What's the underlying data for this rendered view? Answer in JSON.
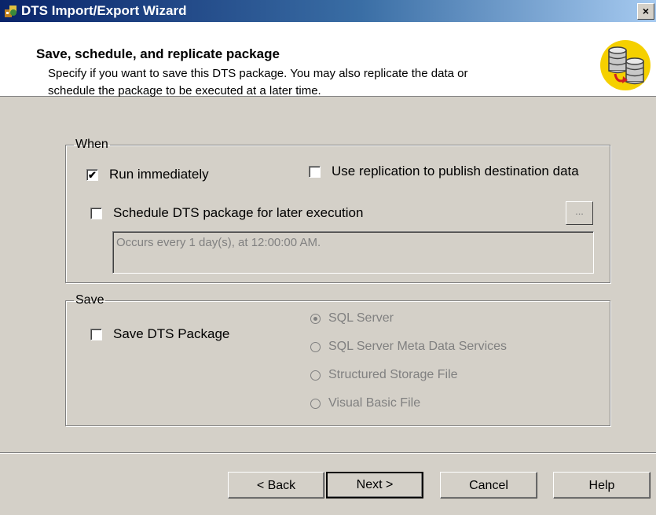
{
  "window": {
    "title": "DTS Import/Export Wizard",
    "close_glyph": "×"
  },
  "header": {
    "title": "Save, schedule, and replicate package",
    "description_line1": "Specify if you want to save this DTS package.  You may also replicate the data or",
    "description_line2": "schedule the package to be executed at a later time.",
    "icon": "database-icon"
  },
  "when": {
    "legend": "When",
    "run_immediately": {
      "label": "Run immediately",
      "checked": true
    },
    "use_replication": {
      "label": "Use replication to publish destination data",
      "checked": false
    },
    "schedule": {
      "label": "Schedule DTS package for later execution",
      "checked": false
    },
    "ellipsis_label": "...",
    "schedule_text": "Occurs every 1 day(s), at 12:00:00 AM."
  },
  "save": {
    "legend": "Save",
    "save_package": {
      "label": "Save DTS Package",
      "checked": false
    },
    "options": [
      {
        "label": "SQL Server",
        "selected": true
      },
      {
        "label": "SQL Server Meta Data Services",
        "selected": false
      },
      {
        "label": "Structured Storage File",
        "selected": false
      },
      {
        "label": "Visual Basic File",
        "selected": false
      }
    ]
  },
  "buttons": {
    "back": "< Back",
    "next": "Next >",
    "cancel": "Cancel",
    "help": "Help"
  },
  "check_glyph": "✔",
  "colors": {
    "titlebar_start": "#0a246a",
    "titlebar_end": "#a6caf0",
    "dialog_bg": "#d4d0c8",
    "disabled_text": "#808080"
  }
}
